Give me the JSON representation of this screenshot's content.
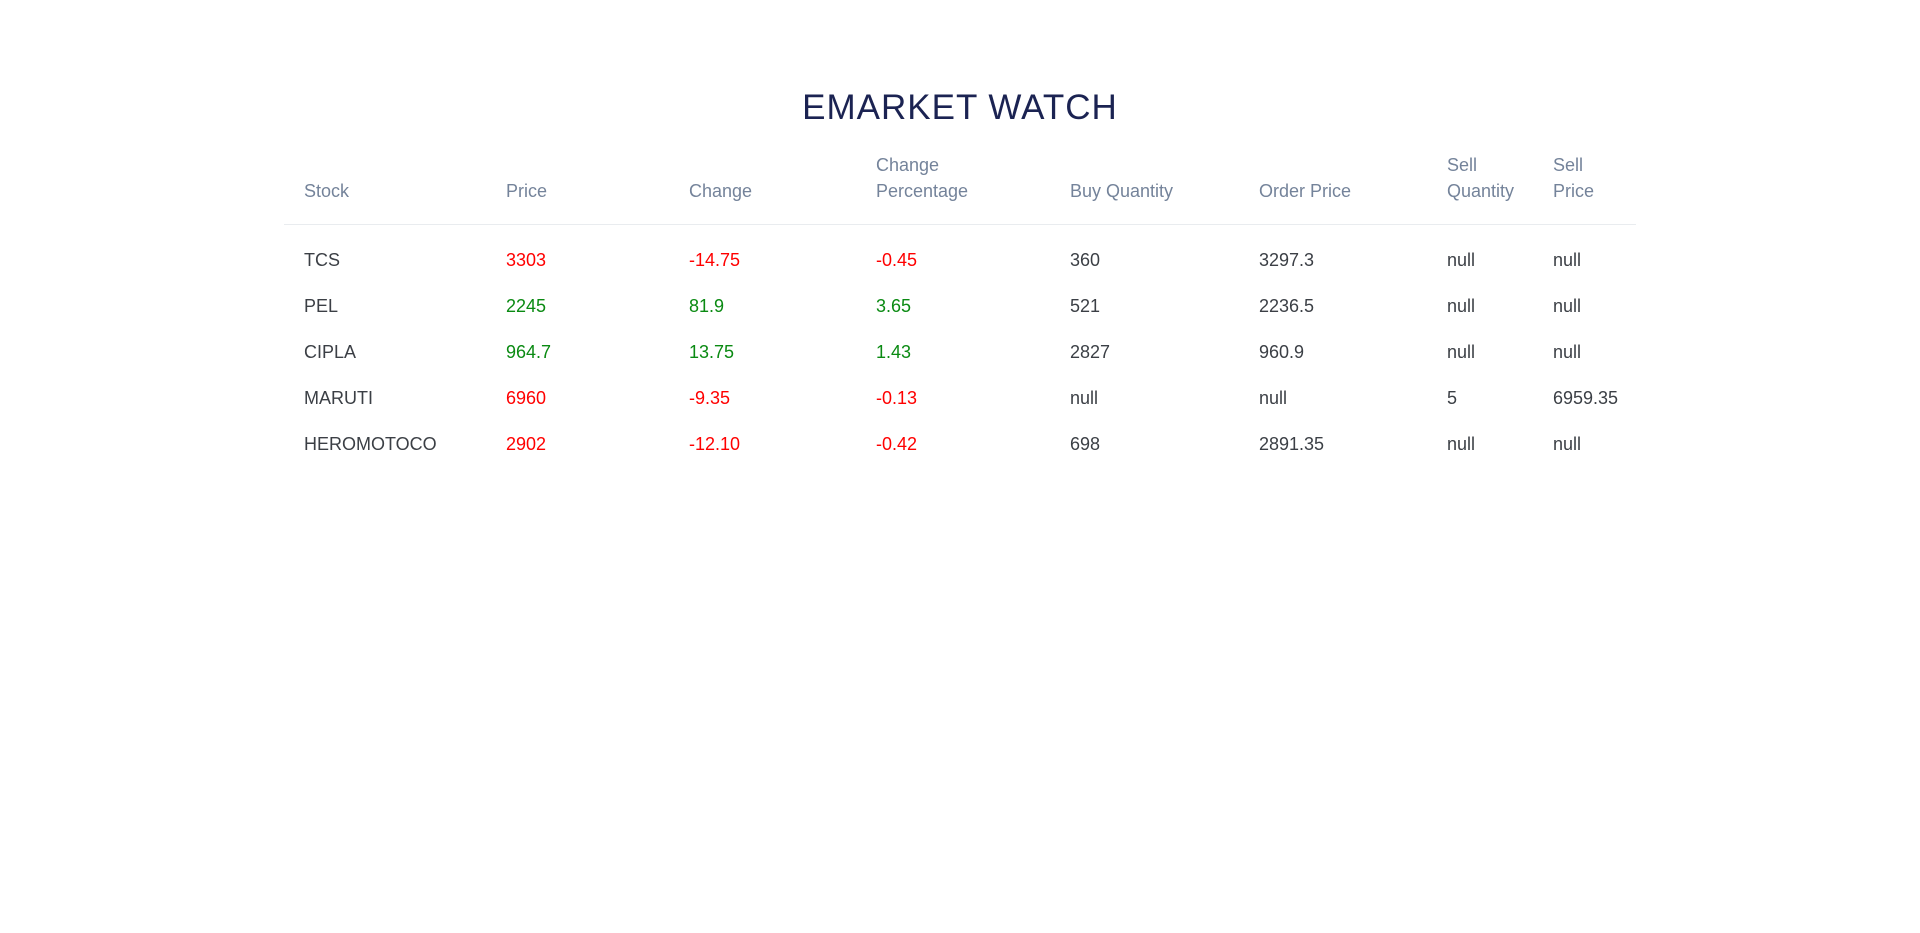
{
  "page": {
    "title": "EMARKET WATCH"
  },
  "colors": {
    "title": "#1b2352",
    "header_text": "#74839a",
    "body_text": "#3b3f45",
    "negative": "#ff0000",
    "positive": "#0a8a12"
  },
  "table": {
    "headers": {
      "stock": "Stock",
      "price": "Price",
      "change": "Change",
      "change_pct": "Change Percentage",
      "buy_qty": "Buy Quantity",
      "order_price": "Order Price",
      "sell_qty_line1": "Sell",
      "sell_qty_line2": "Quantity",
      "sell_price_line1": "Sell",
      "sell_price_line2": "Price"
    },
    "rows": [
      {
        "stock": "TCS",
        "price": "3303",
        "change": "-14.75",
        "change_pct": "-0.45",
        "buy_qty": "360",
        "order_price": "3297.3",
        "sell_qty": "null",
        "sell_price": "null",
        "trend": "neg"
      },
      {
        "stock": "PEL",
        "price": "2245",
        "change": "81.9",
        "change_pct": "3.65",
        "buy_qty": "521",
        "order_price": "2236.5",
        "sell_qty": "null",
        "sell_price": "null",
        "trend": "pos"
      },
      {
        "stock": "CIPLA",
        "price": "964.7",
        "change": "13.75",
        "change_pct": "1.43",
        "buy_qty": "2827",
        "order_price": "960.9",
        "sell_qty": "null",
        "sell_price": "null",
        "trend": "pos"
      },
      {
        "stock": "MARUTI",
        "price": "6960",
        "change": "-9.35",
        "change_pct": "-0.13",
        "buy_qty": "null",
        "order_price": "null",
        "sell_qty": "5",
        "sell_price": "6959.35",
        "trend": "neg"
      },
      {
        "stock": "HEROMOTOCO",
        "price": "2902",
        "change": "-12.10",
        "change_pct": "-0.42",
        "buy_qty": "698",
        "order_price": "2891.35",
        "sell_qty": "null",
        "sell_price": "null",
        "trend": "neg"
      }
    ]
  }
}
